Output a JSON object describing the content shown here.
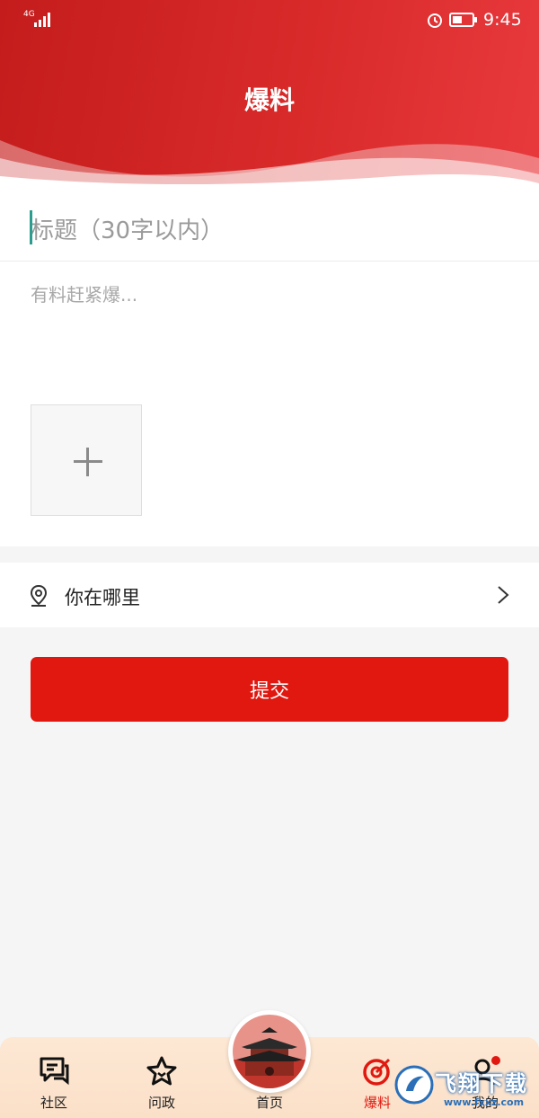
{
  "status_bar": {
    "network": "4G",
    "time": "9:45"
  },
  "header": {
    "title": "爆料"
  },
  "form": {
    "title_placeholder": "标题（30字以内）",
    "content_placeholder": "有料赶紧爆...",
    "location_label": "你在哪里",
    "submit_label": "提交"
  },
  "tabs": [
    {
      "label": "社区",
      "icon": "chat-icon",
      "active": false
    },
    {
      "label": "问政",
      "icon": "star-icon",
      "active": false
    },
    {
      "label": "首页",
      "icon": "home-tower-image",
      "active": false
    },
    {
      "label": "爆料",
      "icon": "target-icon",
      "active": true
    },
    {
      "label": "我的",
      "icon": "profile-icon",
      "active": false
    }
  ],
  "watermark": {
    "text": "飞翔下载",
    "sub": "www.fxxz.com"
  },
  "colors": {
    "brand_red": "#e01810",
    "header_red": "#d42828",
    "active_tab": "#e01810",
    "caret": "#2a9d8f"
  }
}
